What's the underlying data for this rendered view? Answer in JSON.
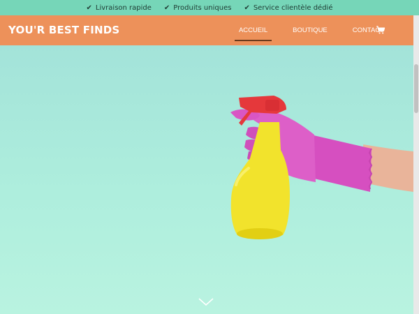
{
  "topbar": {
    "items": [
      {
        "icon": "check-icon",
        "label": "Livraison rapide"
      },
      {
        "icon": "check-icon",
        "label": "Produits uniques"
      },
      {
        "icon": "check-icon",
        "label": "Service clientèle dédié"
      }
    ]
  },
  "header": {
    "logo": "YOU'R BEST FINDS",
    "nav": [
      {
        "label": "ACCUEIL",
        "active": true
      },
      {
        "label": "BOUTIQUE",
        "active": false
      },
      {
        "label": "CONTACT",
        "active": false
      }
    ],
    "cart_icon": "cart-icon"
  },
  "hero": {
    "image": "hand-in-pink-glove-holding-yellow-spray-bottle",
    "scroll_icon": "chevron-down-icon"
  },
  "colors": {
    "topbar_bg": "#76d6b8",
    "header_bg": "#ed915a",
    "hero_bg": "#a6eadf",
    "glove": "#d65ac4",
    "bottle": "#f1e32a",
    "nozzle": "#e8363a"
  }
}
